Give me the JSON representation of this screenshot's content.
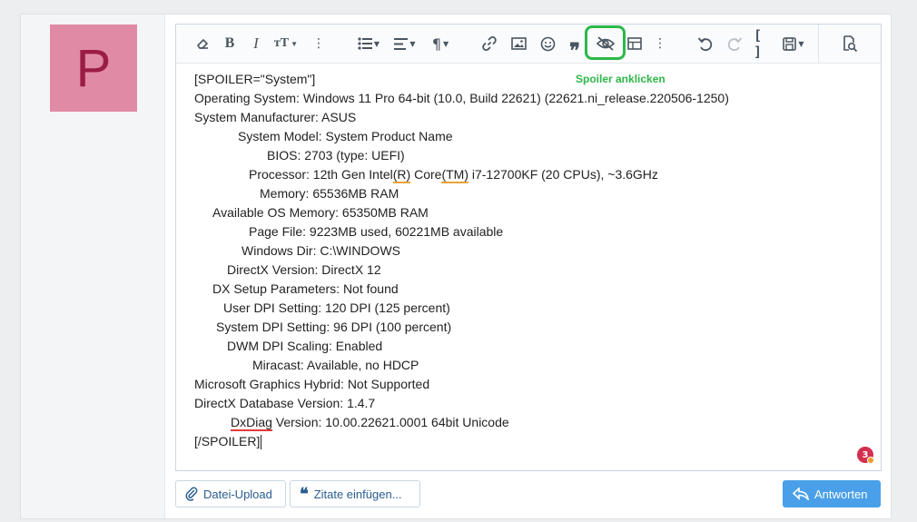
{
  "user": {
    "avatar_letter": "P"
  },
  "toolbar": {
    "buttons": [
      {
        "icon": "eraser-icon"
      },
      {
        "icon": "bold-icon"
      },
      {
        "icon": "italic-icon"
      },
      {
        "icon": "text-size-icon"
      },
      {
        "icon": "more-options-icon"
      },
      {
        "icon": "list-icon"
      },
      {
        "icon": "align-icon"
      },
      {
        "icon": "paragraph-icon"
      },
      {
        "icon": "link-icon"
      },
      {
        "icon": "image-icon"
      },
      {
        "icon": "smiley-icon"
      },
      {
        "icon": "quote-icon"
      },
      {
        "icon": "spoiler-eye-slash-icon"
      },
      {
        "icon": "table-icon"
      },
      {
        "icon": "more-options-icon"
      },
      {
        "icon": "undo-icon"
      },
      {
        "icon": "redo-icon"
      },
      {
        "icon": "bbcode-brackets-icon"
      },
      {
        "icon": "drafts-icon"
      },
      {
        "icon": "preview-icon"
      }
    ],
    "highlight_color": "#2eb84a"
  },
  "annotation": {
    "text": "Spoiler anklicken"
  },
  "content": {
    "lines": [
      "[SPOILER=\"System\"]",
      "Operating System: Windows 11 Pro 64-bit (10.0, Build 22621) (22621.ni_release.220506-1250)",
      "System Manufacturer: ASUS",
      "System Model: System Product Name",
      "BIOS: 2703 (type: UEFI)",
      "Processor: 12th Gen Intel",
      "(R)",
      " Core",
      "(TM)",
      " i7-12700KF (20 CPUs), ~3.6GHz",
      "Memory: 65536MB RAM",
      "Available OS Memory: 65350MB RAM",
      "Page File: 9223MB used, 60221MB available",
      "Windows Dir: C:\\WINDOWS",
      "DirectX Version: DirectX 12",
      "DX Setup Parameters: Not found",
      "User DPI Setting: 120 DPI (125 percent)",
      "System DPI Setting: 96 DPI (100 percent)",
      "DWM DPI Scaling: Enabled",
      "Miracast: Available, no HDCP",
      "Microsoft Graphics Hybrid: Not Supported",
      "DirectX Database Version: 1.4.7",
      "DxDiag",
      " Version: 10.00.22621.0001 64bit Unicode",
      "[/SPOILER]"
    ]
  },
  "badge": {
    "count": "3"
  },
  "footer": {
    "upload_label": "Datei-Upload",
    "quotes_label": "Zitate einfügen...",
    "reply_label": "Antworten"
  }
}
